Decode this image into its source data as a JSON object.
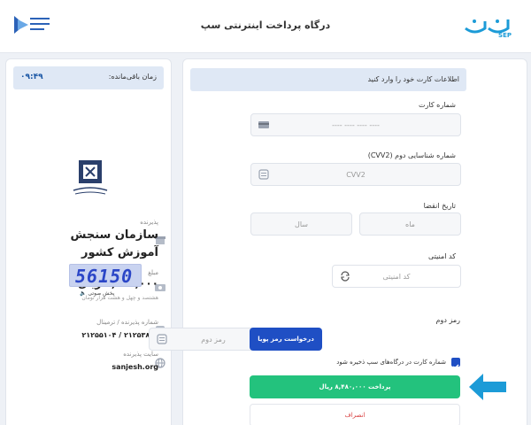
{
  "header": {
    "title": "درگاه پرداخت اینترنتی سپ",
    "sep_logo_text": "SEP",
    "ministry_logo_text": "سازمان سنجش آموزش کشور"
  },
  "info": {
    "timer_label": "زمان باقی‌مانده:",
    "timer_value": "۰۹:۴۹",
    "merchant_label": "پذیرنده",
    "merchant_name": "سازمان سنجش آموزش کشور",
    "amount_label": "مبلغ",
    "amount": "۸,۴۸۰,۰۰۰ ریال",
    "amount_words": "هشتصد و چهل و هشت هزار تومان",
    "ids_label": "شماره پذیرنده / ترمینال",
    "ids_value": "۲۱۲۵۳۸۵۹ / ۲۱۲۵۵۱۰۴",
    "site_label": "سایت پذیرنده",
    "site_value": "sanjesh.org"
  },
  "form": {
    "header": "اطلاعات کارت خود را وارد کنید",
    "card_label": "شماره کارت",
    "card_placeholder": "---- ---- ---- ----",
    "cvv_label": "شماره شناسایی دوم (CVV2)",
    "cvv_placeholder": "CVV2",
    "expiry_label": "تاریخ انقضا",
    "month_placeholder": "ماه",
    "year_placeholder": "سال",
    "captcha_label": "کد امنیتی",
    "captcha_placeholder": "کد امنیتی",
    "captcha_value": "56150",
    "audio_label": "پخش صوتی",
    "pin_label": "رمز دوم",
    "pin_placeholder": "رمز دوم",
    "dynamic_pin_button": "درخواست رمز پویا",
    "save_card_label": "شماره کارت در درگاه‌های سپ ذخیره شود",
    "pay_button": "پرداخت ۸,۴۸۰,۰۰۰ ریال",
    "cancel_button": "انصراف"
  },
  "colors": {
    "primary": "#1f4fc4",
    "pay": "#23c27d",
    "cancel": "#d84040",
    "arrow": "#1c9bd7"
  }
}
